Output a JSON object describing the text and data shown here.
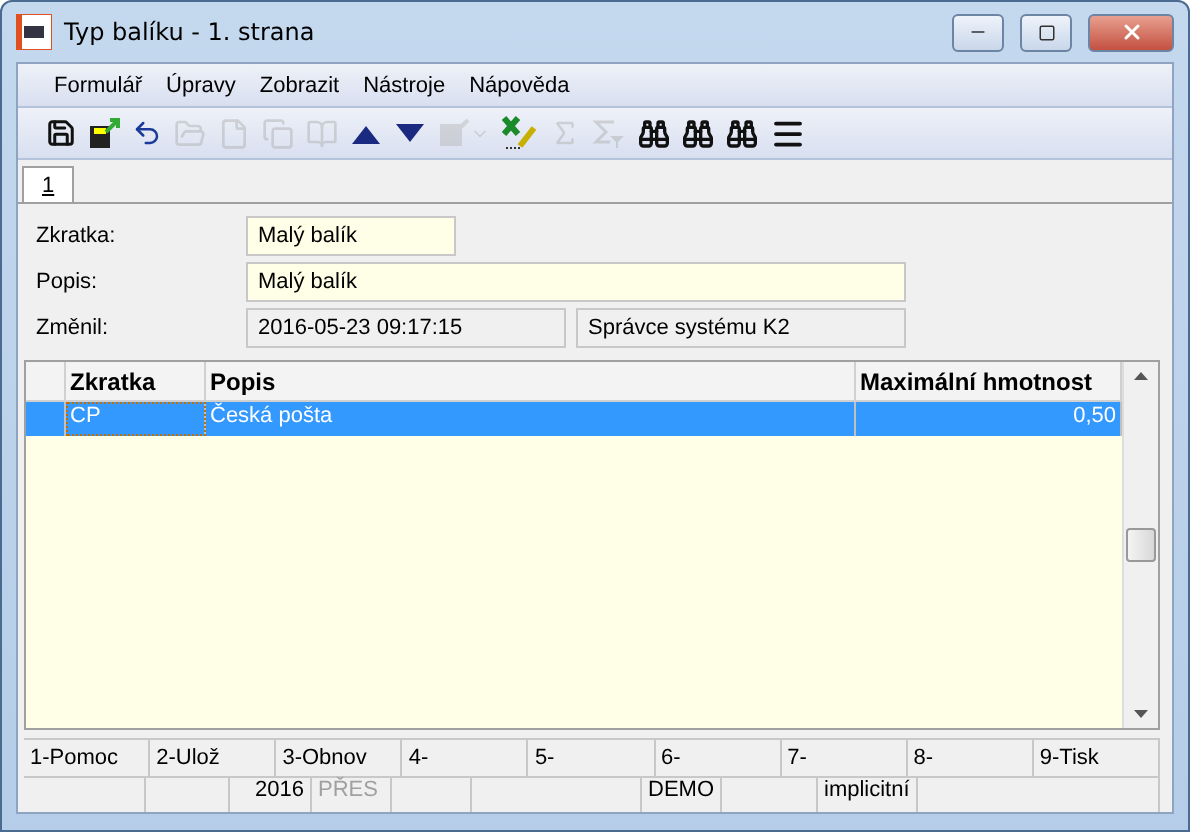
{
  "window": {
    "title": "Typ balíku - 1. strana"
  },
  "menu": [
    {
      "label": "Formulář"
    },
    {
      "label": "Úpravy"
    },
    {
      "label": "Zobrazit"
    },
    {
      "label": "Nástroje"
    },
    {
      "label": "Nápověda"
    }
  ],
  "toolbar": [
    {
      "kind": "save",
      "disabled": false
    },
    {
      "kind": "export",
      "disabled": false
    },
    {
      "kind": "undo",
      "disabled": false
    },
    {
      "kind": "folder",
      "disabled": true
    },
    {
      "kind": "file",
      "disabled": true
    },
    {
      "kind": "copy",
      "disabled": true
    },
    {
      "kind": "book",
      "disabled": true
    },
    {
      "kind": "up",
      "disabled": false
    },
    {
      "kind": "down",
      "disabled": false
    },
    {
      "kind": "dropdown",
      "disabled": true
    },
    {
      "kind": "excel",
      "disabled": false
    },
    {
      "kind": "sigma",
      "disabled": true
    },
    {
      "kind": "sigmafilter",
      "disabled": true
    },
    {
      "kind": "find",
      "disabled": false
    },
    {
      "kind": "findup",
      "disabled": false
    },
    {
      "kind": "finddown",
      "disabled": false
    },
    {
      "kind": "menu",
      "disabled": false
    }
  ],
  "tabs": [
    {
      "label": "1",
      "selected": true
    }
  ],
  "form": {
    "zkratka": {
      "label": "Zkratka:",
      "value": "Malý balík"
    },
    "popis": {
      "label": "Popis:",
      "value": "Malý balík"
    },
    "zmenil": {
      "label": "Změnil:",
      "date": "2016-05-23 09:17:15",
      "user": "Správce systému K2"
    }
  },
  "table": {
    "columns": [
      "Zkratka",
      "Popis",
      "Maximální hmotnost"
    ],
    "rows": [
      {
        "cells": [
          "CP",
          "Česká pošta",
          "0,50"
        ],
        "selected": true
      }
    ]
  },
  "function_keys": [
    "1-Pomoc",
    "2-Ulož",
    "3-Obnov",
    "4-",
    "5-",
    "6-",
    "7-",
    "8-",
    "9-Tisk"
  ],
  "status_bar": [
    {
      "text": "2016",
      "disabled": false
    },
    {
      "text": "PŘES",
      "disabled": true
    },
    {
      "text": "DEMO",
      "disabled": false
    },
    {
      "text": "implicitní",
      "disabled": false
    }
  ]
}
